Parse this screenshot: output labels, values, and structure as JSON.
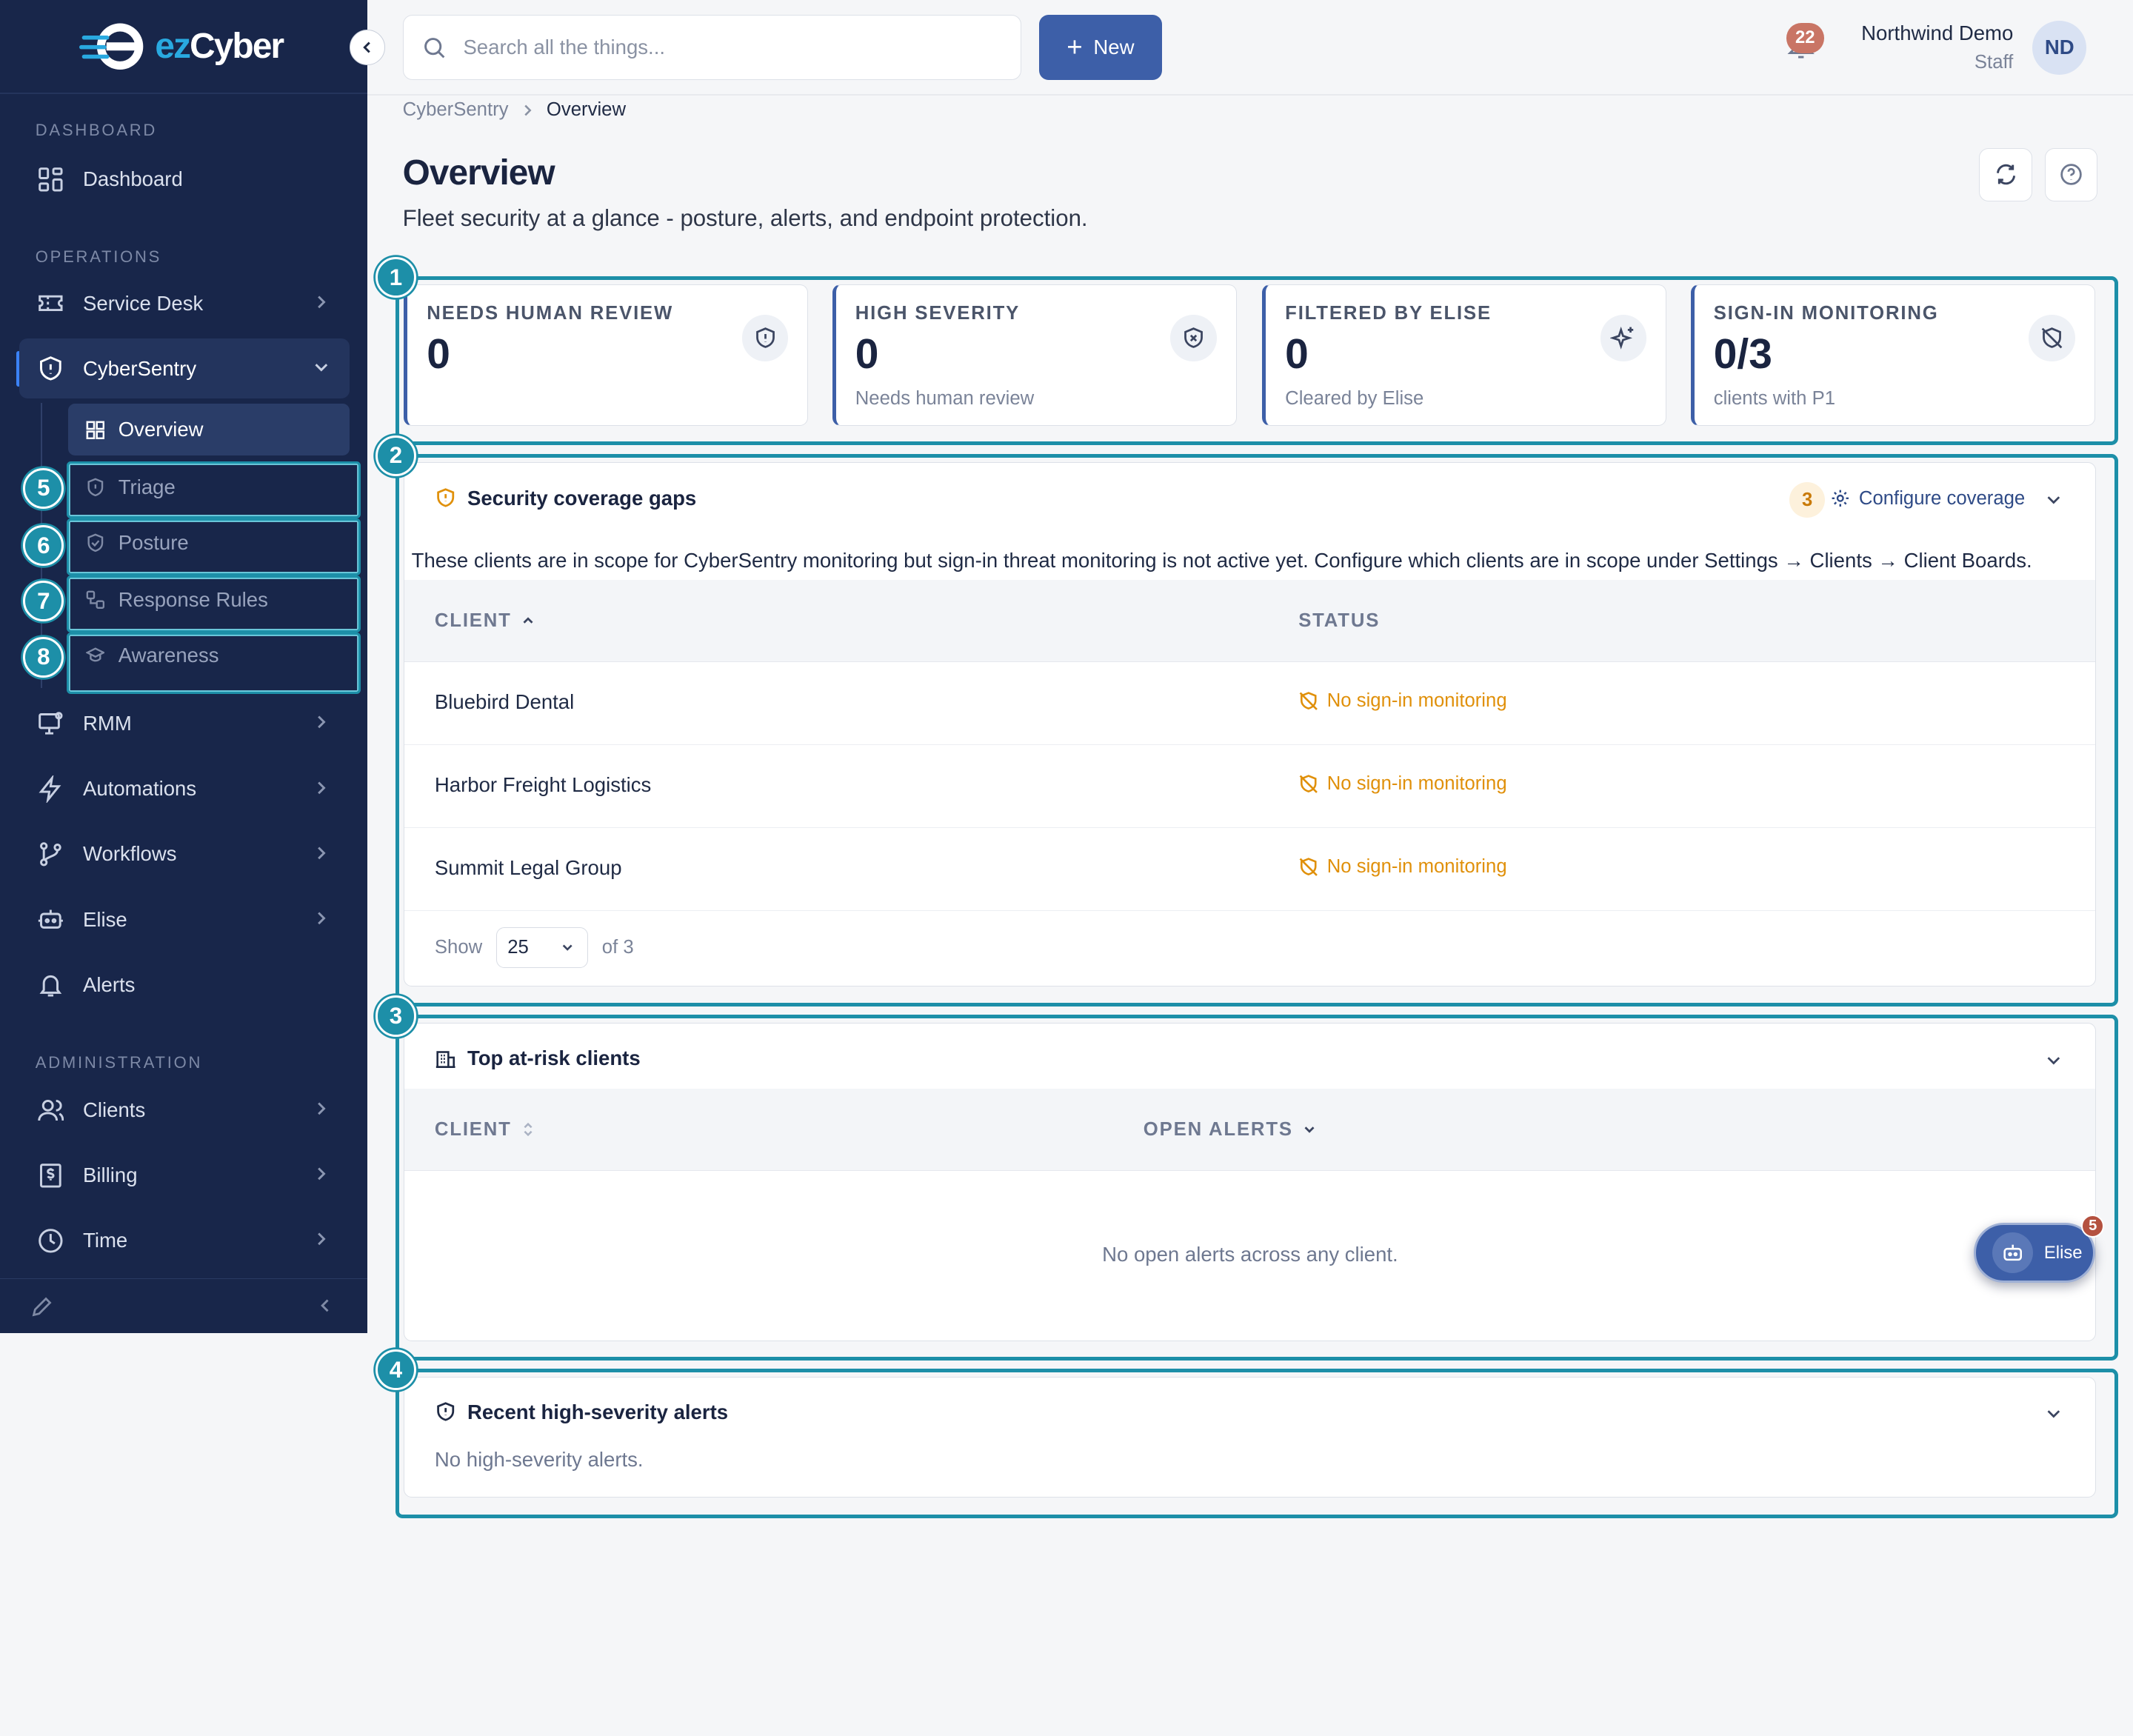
{
  "app": {
    "logo_ez": "ez",
    "logo_cyber": "Cyber"
  },
  "sidebar": {
    "sections": {
      "dashboard": "DASHBOARD",
      "operations": "OPERATIONS",
      "administration": "ADMINISTRATION"
    },
    "items": {
      "dashboard": "Dashboard",
      "service_desk": "Service Desk",
      "cybersentry": "CyberSentry",
      "rmm": "RMM",
      "automations": "Automations",
      "workflows": "Workflows",
      "elise": "Elise",
      "alerts": "Alerts",
      "clients": "Clients",
      "billing": "Billing",
      "time": "Time"
    },
    "subitems": {
      "overview": "Overview",
      "triage": "Triage",
      "posture": "Posture",
      "response_rules": "Response Rules",
      "awareness": "Awareness"
    }
  },
  "topbar": {
    "search_placeholder": "Search all the things...",
    "new_label": "New",
    "notification_count": "22",
    "user_name": "Northwind Demo",
    "user_role": "Staff",
    "user_initials": "ND"
  },
  "page": {
    "breadcrumb_parent": "CyberSentry",
    "breadcrumb_current": "Overview",
    "title": "Overview",
    "subtitle": "Fleet security at a glance - posture, alerts, and endpoint protection."
  },
  "annotations": [
    "1",
    "2",
    "3",
    "4",
    "5",
    "6",
    "7",
    "8"
  ],
  "stats": [
    {
      "label": "NEEDS HUMAN REVIEW",
      "value": "0",
      "note": ""
    },
    {
      "label": "HIGH SEVERITY",
      "value": "0",
      "note": "Needs human review"
    },
    {
      "label": "FILTERED BY ELISE",
      "value": "0",
      "note": "Cleared by Elise"
    },
    {
      "label": "SIGN-IN MONITORING",
      "value": "0/3",
      "note": "clients with P1"
    }
  ],
  "coverage": {
    "title": "Security coverage gaps",
    "count": "3",
    "configure_label": "Configure coverage",
    "description": "These clients are in scope for CyberSentry monitoring but sign-in threat monitoring is not active yet. Configure which clients are in scope under Settings → Clients → Client Boards.",
    "columns": [
      "CLIENT",
      "STATUS"
    ],
    "rows": [
      {
        "client": "Bluebird Dental",
        "status": "No sign-in monitoring"
      },
      {
        "client": "Harbor Freight Logistics",
        "status": "No sign-in monitoring"
      },
      {
        "client": "Summit Legal Group",
        "status": "No sign-in monitoring"
      }
    ],
    "pager": {
      "show_label": "Show",
      "page_size": "25",
      "of_label": "of 3"
    }
  },
  "at_risk": {
    "title": "Top at-risk clients",
    "columns": [
      "CLIENT",
      "OPEN ALERTS"
    ],
    "empty": "No open alerts across any client."
  },
  "recent": {
    "title": "Recent high-severity alerts",
    "empty": "No high-severity alerts."
  },
  "elise_fab": {
    "label": "Elise",
    "badge": "5"
  },
  "colors": {
    "sidebar_bg": "#18264a",
    "accent": "#3d5fa8",
    "highlight": "#1d8fa8",
    "warning": "#e0900a"
  }
}
